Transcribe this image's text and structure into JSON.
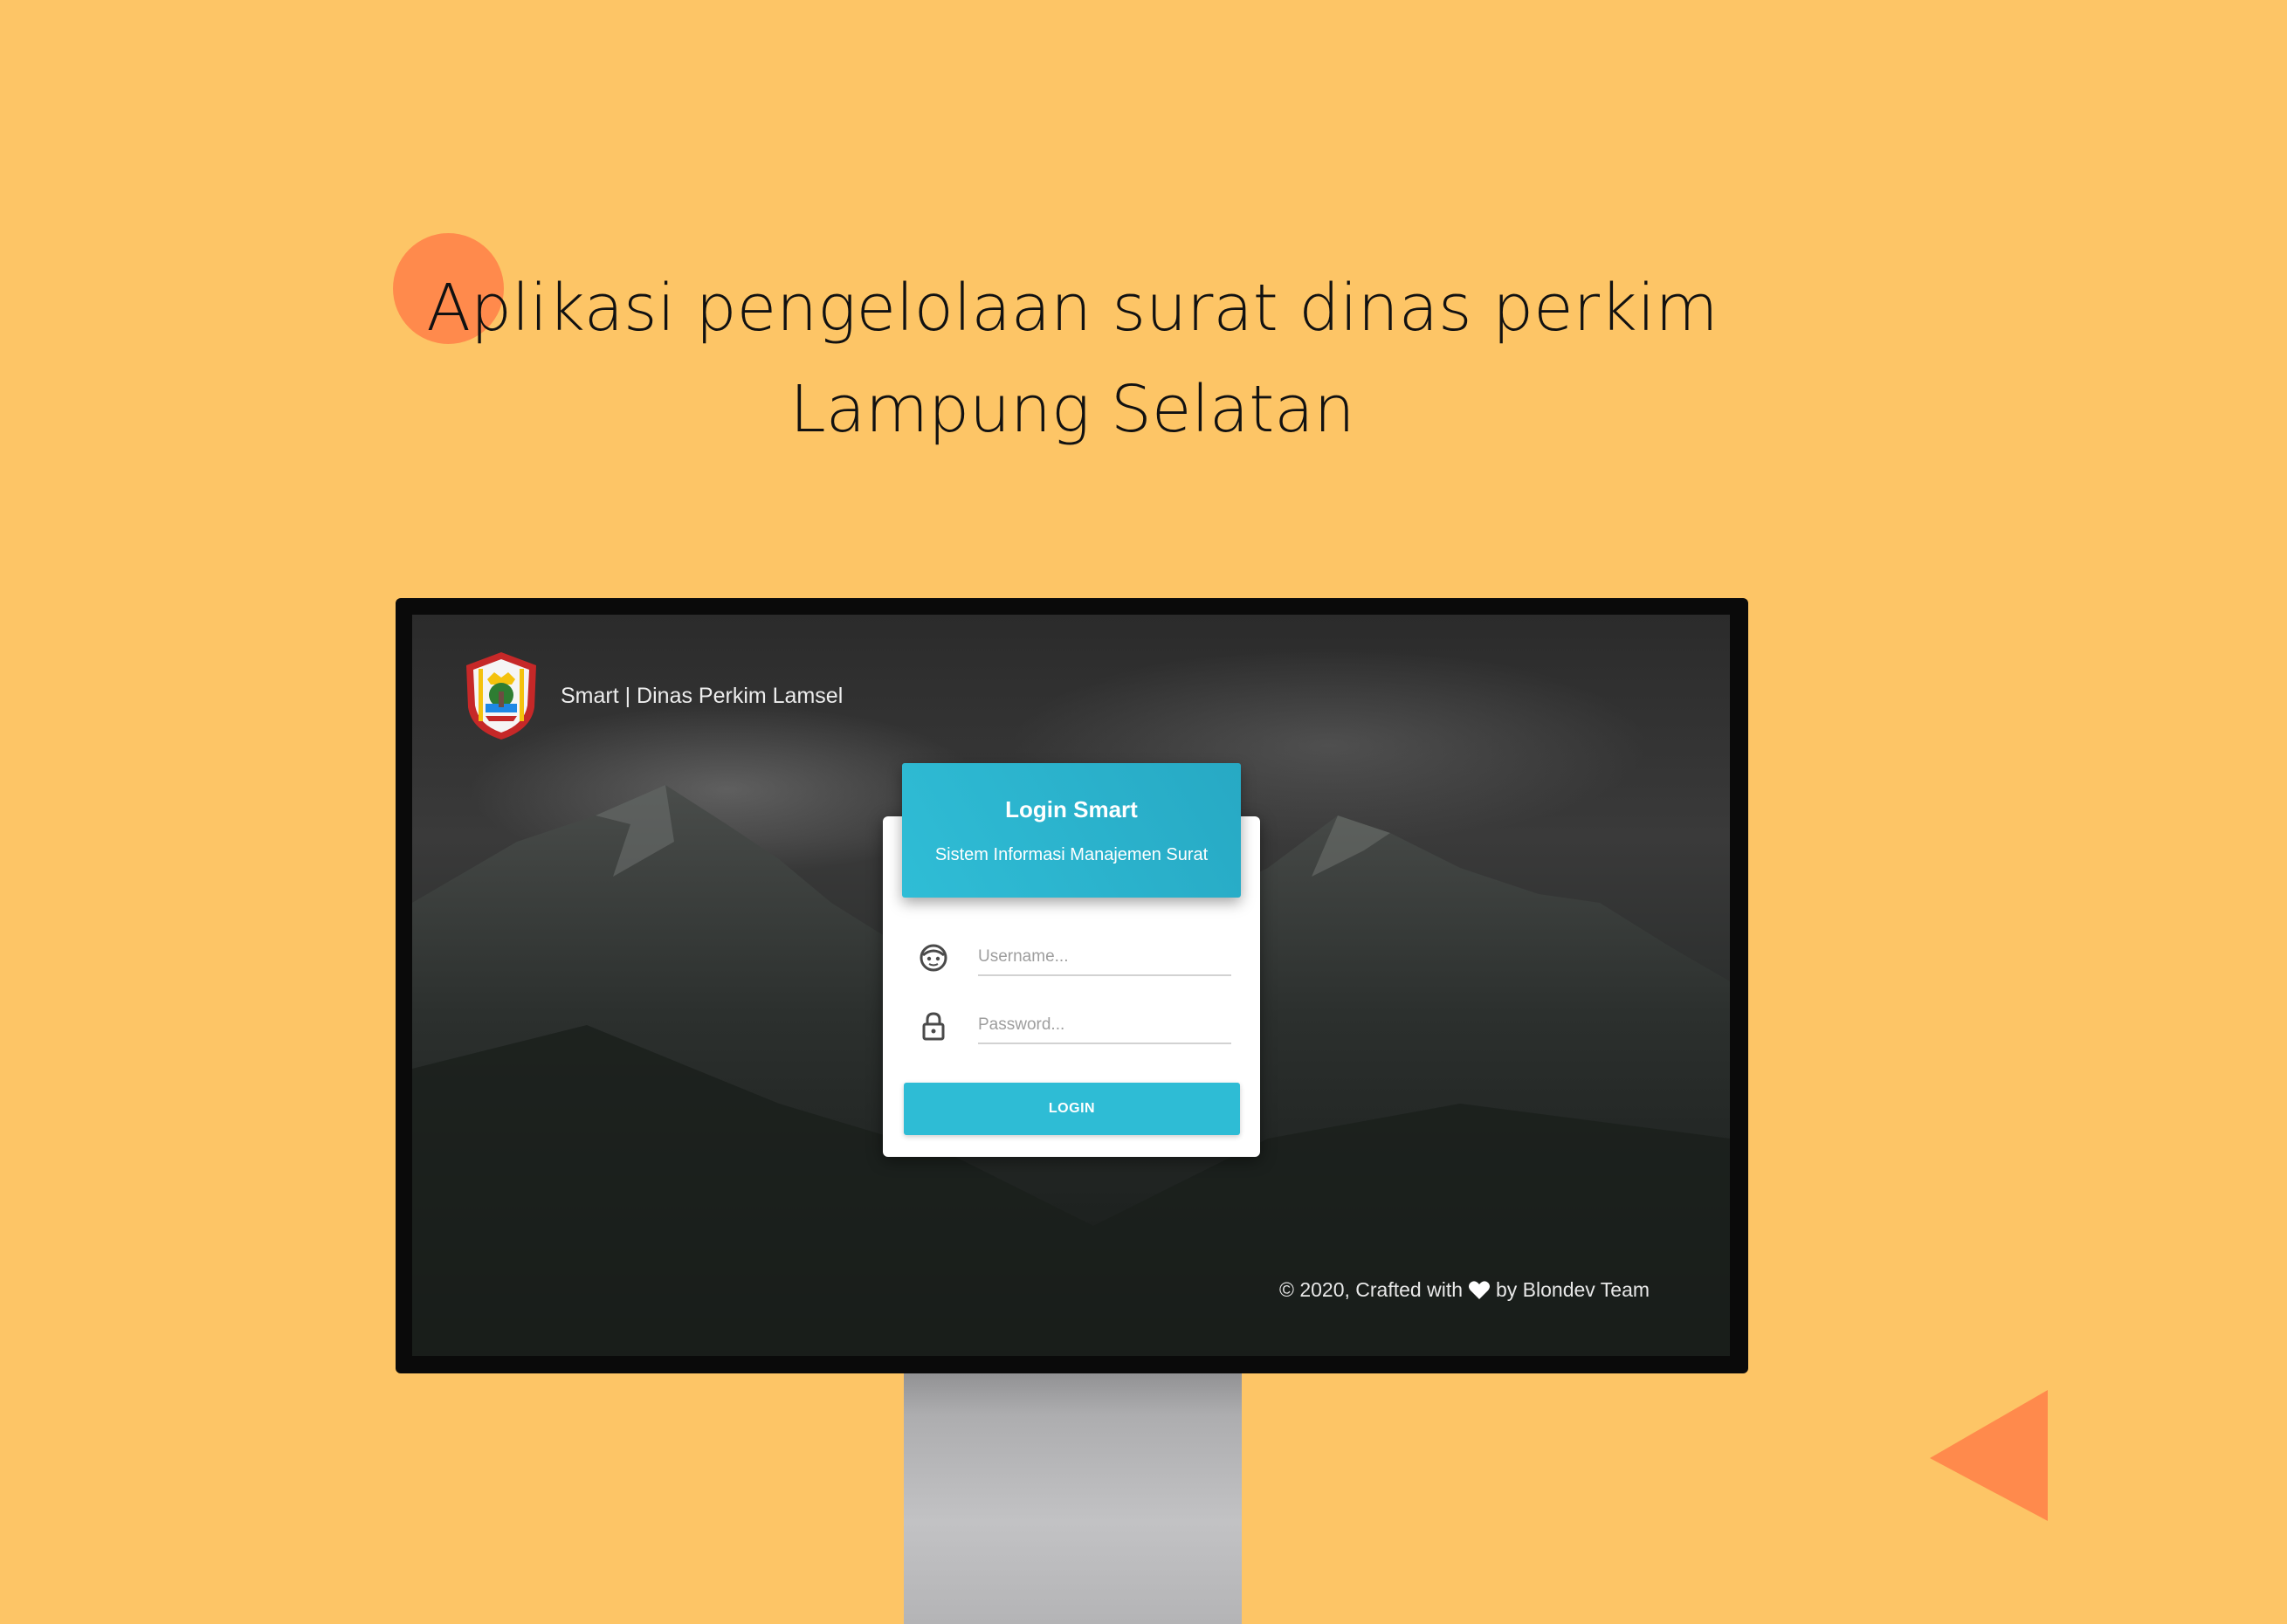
{
  "page": {
    "headline_line1": "Aplikasi pengelolaan surat dinas perkim",
    "headline_line2": "Lampung Selatan"
  },
  "app": {
    "brand_title": "Smart | Dinas Perkim Lamsel",
    "logo_icon": "lampung-selatan-emblem-icon"
  },
  "login": {
    "title": "Login Smart",
    "subtitle": "Sistem Informasi Manajemen Surat",
    "username": {
      "value": "",
      "placeholder": "Username...",
      "icon": "face-icon"
    },
    "password": {
      "value": "",
      "placeholder": "Password...",
      "icon": "lock-icon"
    },
    "button_label": "LOGIN"
  },
  "footer": {
    "prefix": "© 2020, Crafted with",
    "suffix": "by Blondev Team",
    "icon": "heart-icon"
  },
  "colors": {
    "background": "#FDC566",
    "accent_orange": "#FF8A4C",
    "primary_cyan": "#2EBCD5"
  }
}
